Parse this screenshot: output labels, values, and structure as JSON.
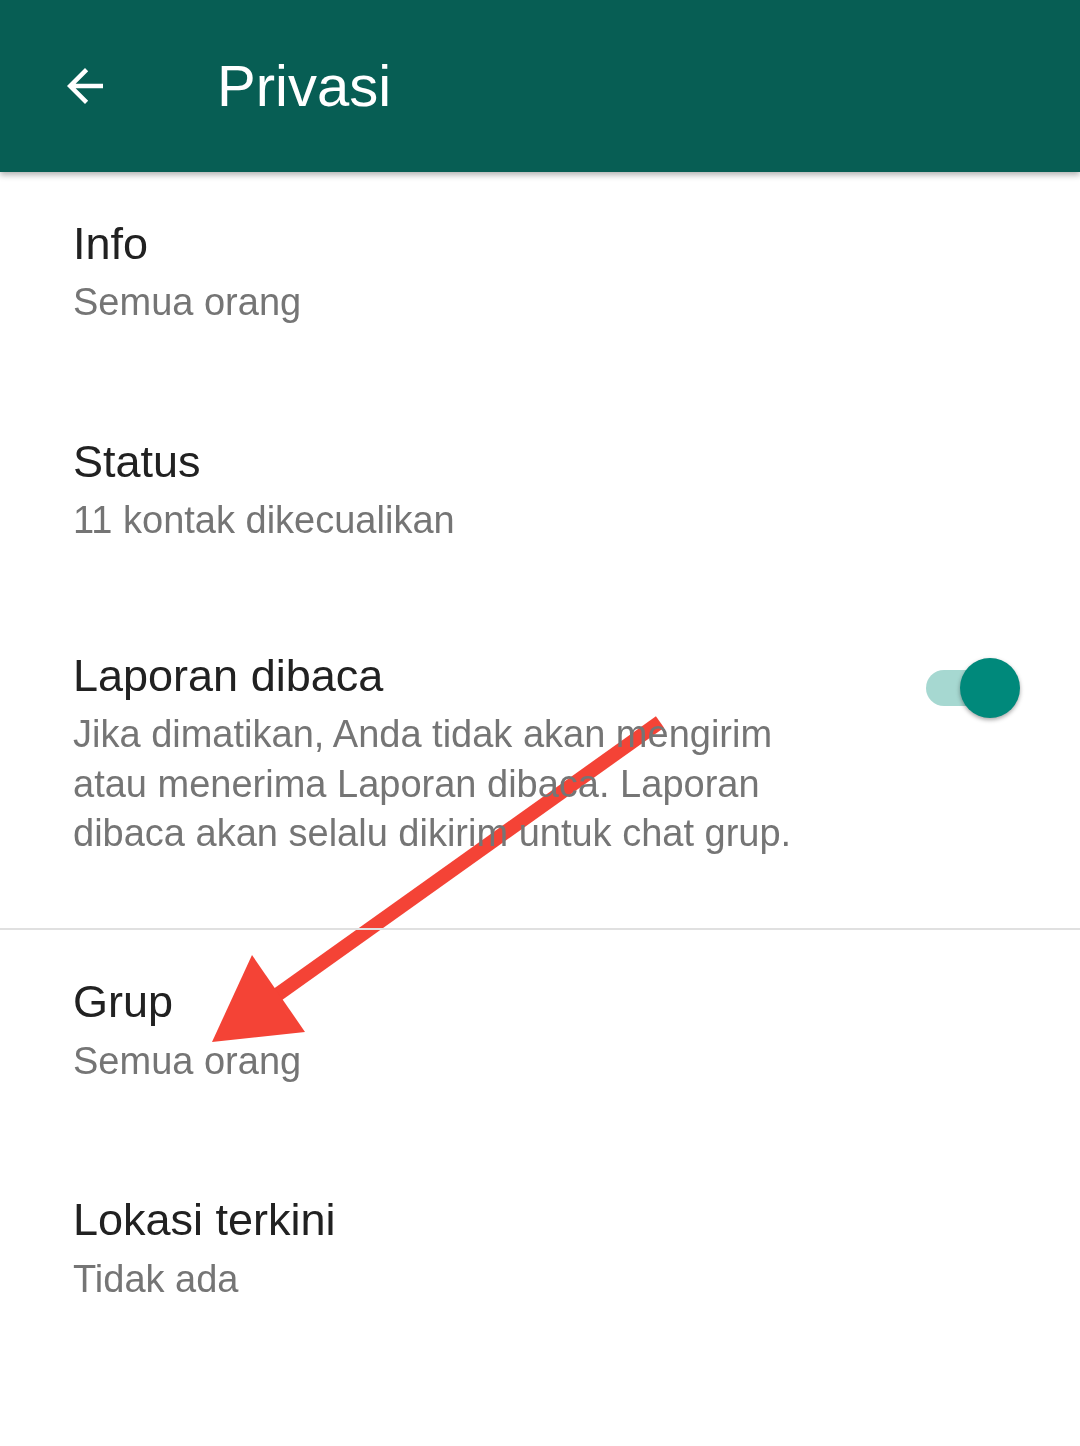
{
  "header": {
    "title": "Privasi"
  },
  "sections": [
    {
      "items": [
        {
          "kind": "value",
          "title": "Info",
          "subtitle": "Semua orang"
        },
        {
          "kind": "value",
          "title": "Status",
          "subtitle": "11 kontak dikecualikan"
        },
        {
          "kind": "toggle",
          "title": "Laporan dibaca",
          "subtitle": "Jika dimatikan, Anda tidak akan mengirim atau menerima Laporan dibaca. Laporan dibaca akan selalu dikirim untuk chat grup.",
          "on": true
        }
      ]
    },
    {
      "items": [
        {
          "kind": "value",
          "title": "Grup",
          "subtitle": "Semua orang"
        },
        {
          "kind": "value",
          "title": "Lokasi terkini",
          "subtitle": "Tidak ada"
        }
      ]
    }
  ]
}
